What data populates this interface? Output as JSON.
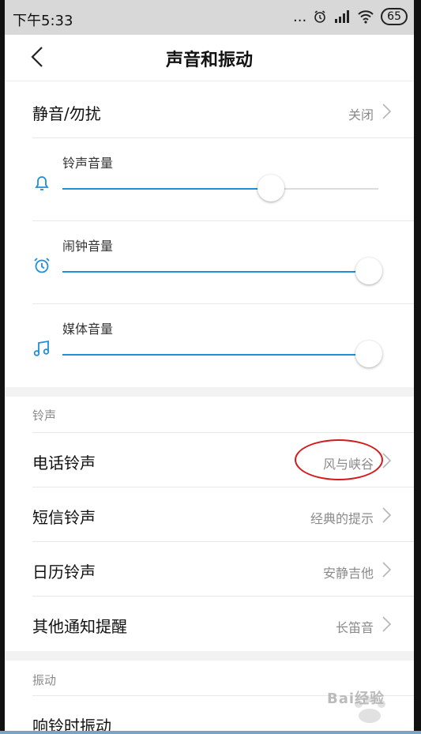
{
  "status": {
    "time": "下午5:33",
    "dots": "...",
    "battery": "65"
  },
  "header": {
    "title": "声音和振动"
  },
  "dnd": {
    "label": "静音/勿扰",
    "value": "关闭"
  },
  "volume": {
    "ringtone": {
      "label": "铃声音量",
      "level": 0.66
    },
    "alarm": {
      "label": "闹钟音量",
      "level": 0.97
    },
    "media": {
      "label": "媒体音量",
      "level": 0.97
    }
  },
  "ringtone_section": {
    "title": "铃声",
    "items": [
      {
        "label": "电话铃声",
        "value": "风与峡谷"
      },
      {
        "label": "短信铃声",
        "value": "经典的提示"
      },
      {
        "label": "日历铃声",
        "value": "安静吉他"
      },
      {
        "label": "其他通知提醒",
        "value": "长笛音"
      }
    ]
  },
  "vibration_section": {
    "title": "振动",
    "items": [
      {
        "label": "响铃时振动"
      }
    ]
  },
  "colors": {
    "accent": "#1e8fd8",
    "annotation": "#d41b1b"
  },
  "watermark": {
    "text": "Bai经验"
  }
}
